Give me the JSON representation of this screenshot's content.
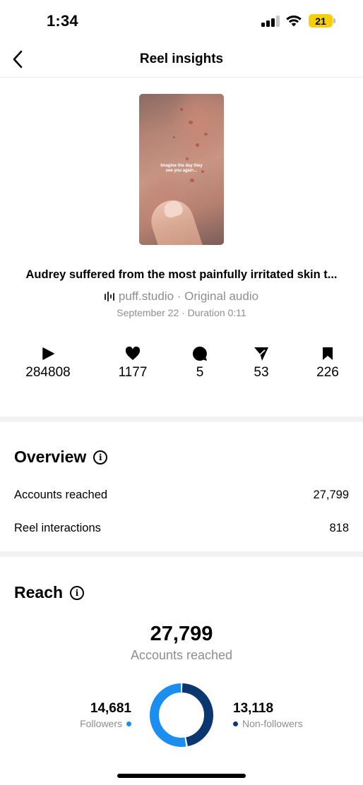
{
  "status_bar": {
    "time": "1:34",
    "battery": "21",
    "battery_color": "#f5cf0a"
  },
  "header": {
    "title": "Reel insights",
    "back_icon": "chevron-left-icon"
  },
  "reel": {
    "thumbnail_caption": "Imagine the day they see you again...",
    "title": "Audrey suffered from the most painfully irritated skin t...",
    "audio": "puff.studio · Original audio",
    "date_duration": "September 22 · Duration 0:11"
  },
  "metrics": [
    {
      "icon": "play-icon",
      "value": "284808"
    },
    {
      "icon": "heart-icon",
      "value": "1177"
    },
    {
      "icon": "comment-icon",
      "value": "5"
    },
    {
      "icon": "share-icon",
      "value": "53"
    },
    {
      "icon": "bookmark-icon",
      "value": "226"
    }
  ],
  "overview": {
    "title": "Overview",
    "rows": [
      {
        "label": "Accounts reached",
        "value": "27,799"
      },
      {
        "label": "Reel interactions",
        "value": "818"
      }
    ]
  },
  "reach": {
    "title": "Reach",
    "total": "27,799",
    "total_label": "Accounts reached",
    "followers": {
      "value": "14,681",
      "label": "Followers",
      "color": "#1c8ef0",
      "count": 14681
    },
    "non_followers": {
      "value": "13,118",
      "label": "Non-followers",
      "color": "#0a3770",
      "count": 13118
    }
  }
}
